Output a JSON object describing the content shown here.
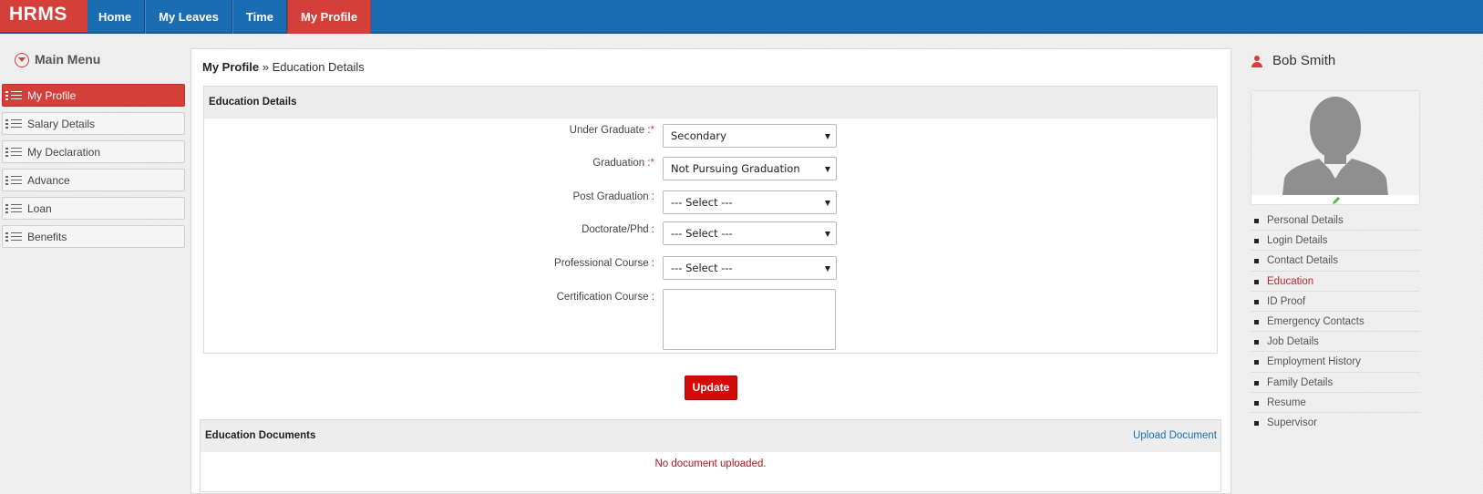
{
  "brand": "HRMS",
  "nav": [
    {
      "label": "Home",
      "active": false
    },
    {
      "label": "My Leaves",
      "active": false
    },
    {
      "label": "Time",
      "active": false
    },
    {
      "label": "My Profile",
      "active": true
    }
  ],
  "sidebar": {
    "title": "Main Menu",
    "items": [
      {
        "label": "My Profile",
        "active": true
      },
      {
        "label": "Salary Details",
        "active": false
      },
      {
        "label": "My Declaration",
        "active": false
      },
      {
        "label": "Advance",
        "active": false
      },
      {
        "label": "Loan",
        "active": false
      },
      {
        "label": "Benefits",
        "active": false
      }
    ]
  },
  "breadcrumb": {
    "parent": "My Profile",
    "separator": "»",
    "current": "Education Details"
  },
  "education": {
    "title": "Education Details",
    "fields": [
      {
        "label": "Under Graduate :",
        "required": true,
        "value": "Secondary"
      },
      {
        "label": "Graduation :",
        "required": true,
        "value": "Not Pursuing Graduation"
      },
      {
        "label": "Post Graduation :",
        "required": false,
        "value": "--- Select ---"
      },
      {
        "label": "Doctorate/Phd :",
        "required": false,
        "value": "--- Select ---"
      },
      {
        "label": "Professional Course :",
        "required": false,
        "value": "--- Select ---"
      },
      {
        "label": "Certification Course :",
        "required": false,
        "value": ""
      }
    ],
    "required_mark": "*",
    "update_label": "Update"
  },
  "documents": {
    "title": "Education Documents",
    "upload_label": "Upload Document",
    "empty_message": "No document uploaded."
  },
  "profile": {
    "name": "Bob Smith",
    "links": [
      {
        "label": "Personal Details",
        "active": false
      },
      {
        "label": "Login Details",
        "active": false
      },
      {
        "label": "Contact Details",
        "active": false
      },
      {
        "label": "Education",
        "active": true
      },
      {
        "label": "ID Proof",
        "active": false
      },
      {
        "label": "Emergency Contacts",
        "active": false
      },
      {
        "label": "Job Details",
        "active": false
      },
      {
        "label": "Employment History",
        "active": false
      },
      {
        "label": "Family Details",
        "active": false
      },
      {
        "label": "Resume",
        "active": false
      },
      {
        "label": "Supervisor",
        "active": false
      }
    ]
  },
  "colors": {
    "nav": "#1a6db3",
    "accent": "#d43f3a",
    "button": "#d40b0b",
    "link": "#1a6db3"
  }
}
